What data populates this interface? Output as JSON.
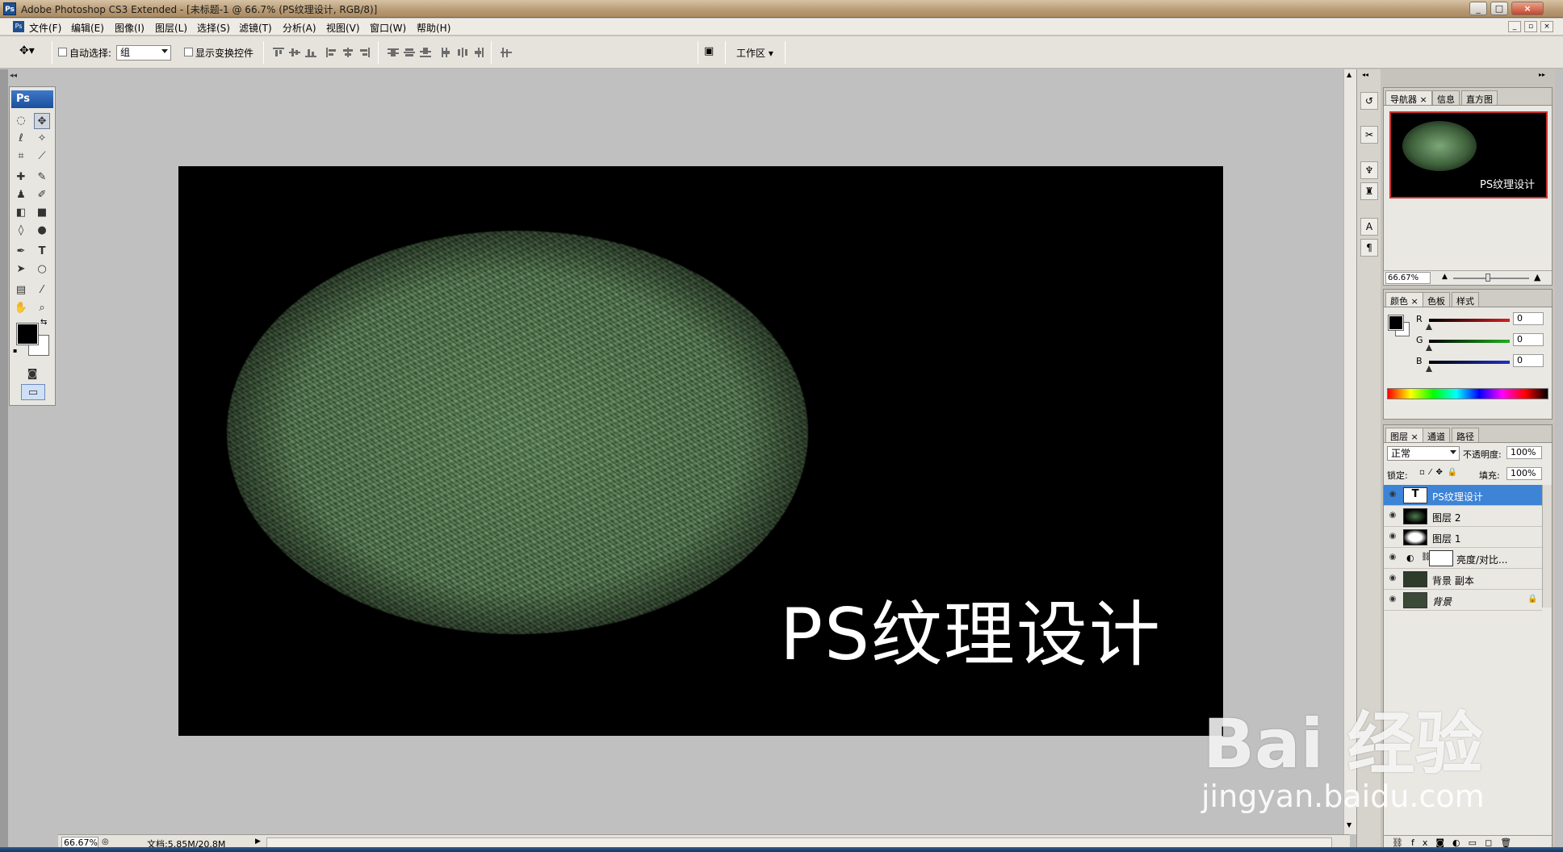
{
  "window": {
    "title": "Adobe Photoshop CS3 Extended - [未标题-1 @ 66.7% (PS纹理设计, RGB/8)]",
    "controls": [
      "_",
      "□",
      "×"
    ]
  },
  "menubar": {
    "items": [
      "文件(F)",
      "编辑(E)",
      "图像(I)",
      "图层(L)",
      "选择(S)",
      "滤镜(T)",
      "分析(A)",
      "视图(V)",
      "窗口(W)",
      "帮助(H)"
    ]
  },
  "options": {
    "auto_select_label": "自动选择:",
    "auto_select_value": "组",
    "show_transform_label": "显示变换控件",
    "workspace_label": "工作区"
  },
  "toolbox": {
    "logo": "Ps"
  },
  "document": {
    "text": "PS纹理设计"
  },
  "statusbar": {
    "zoom": "66.67%",
    "doc_info": "文档:5.85M/20.8M"
  },
  "navigator": {
    "tabs": [
      "导航器",
      "信息",
      "直方图"
    ],
    "thumb_text": "PS纹理设计",
    "zoom": "66.67%"
  },
  "color": {
    "tabs": [
      "颜色",
      "色板",
      "样式"
    ],
    "channels": [
      {
        "name": "R",
        "value": "0",
        "color": "#d42020"
      },
      {
        "name": "G",
        "value": "0",
        "color": "#20b020"
      },
      {
        "name": "B",
        "value": "0",
        "color": "#2030c8"
      }
    ]
  },
  "layers": {
    "tabs": [
      "图层",
      "通道",
      "路径"
    ],
    "blend_mode": "正常",
    "opacity_label": "不透明度:",
    "opacity_value": "100%",
    "lock_label": "锁定:",
    "fill_label": "填充:",
    "fill_value": "100%",
    "items": [
      {
        "name": "PS纹理设计",
        "thumb": "T",
        "selected": true
      },
      {
        "name": "图层 2",
        "thumb": "",
        "selected": false
      },
      {
        "name": "图层 1",
        "thumb": "",
        "selected": false
      },
      {
        "name": "亮度/对比...",
        "thumb": "",
        "selected": false
      },
      {
        "name": "背景 副本",
        "thumb": "",
        "selected": false
      },
      {
        "name": "背景",
        "thumb": "",
        "selected": false
      }
    ]
  },
  "watermark": {
    "brand": "Bai 经验",
    "url": "jingyan.baidu.com"
  }
}
